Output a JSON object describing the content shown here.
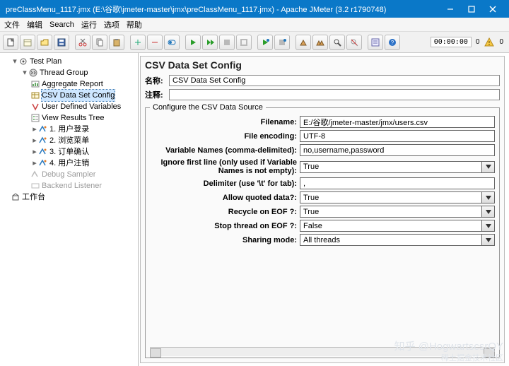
{
  "window": {
    "title": "preClassMenu_1117.jmx (E:\\谷歌\\jmeter-master\\jmx\\preClassMenu_1117.jmx) - Apache JMeter (3.2 r1790748)"
  },
  "menu": {
    "file": "文件",
    "edit": "编辑",
    "search": "Search",
    "run": "运行",
    "options": "选项",
    "help": "帮助"
  },
  "toolbar": {
    "timer": "00:00:00",
    "count": "0",
    "warnCount": "0"
  },
  "tree": {
    "root": "Test Plan",
    "group": "Thread Group",
    "items": [
      "Aggregate Report",
      "CSV Data Set Config",
      "User Defined Variables",
      "View Results Tree",
      "1. 用户登录",
      "2. 浏览菜单",
      "3. 订单确认",
      "4. 用户注销",
      "Debug Sampler",
      "Backend Listener"
    ],
    "workbench": "工作台"
  },
  "panel": {
    "title": "CSV Data Set Config",
    "nameLabel": "名称:",
    "nameValue": "CSV Data Set Config",
    "commentLabel": "注释:",
    "commentValue": "",
    "fieldsetLegend": "Configure the CSV Data Source",
    "fields": {
      "filename": {
        "label": "Filename:",
        "value": "E:/谷歌/jmeter-master/jmx/users.csv"
      },
      "encoding": {
        "label": "File encoding:",
        "value": "UTF-8"
      },
      "varnames": {
        "label": "Variable Names (comma-delimited):",
        "value": "no,username,password"
      },
      "ignoreFirst": {
        "label": "Ignore first line (only used if Variable Names is not empty):",
        "value": "True"
      },
      "delimiter": {
        "label": "Delimiter (use '\\t' for tab):",
        "value": ","
      },
      "allowQuoted": {
        "label": "Allow quoted data?:",
        "value": "True"
      },
      "recycle": {
        "label": "Recycle on EOF ?:",
        "value": "True"
      },
      "stopThread": {
        "label": "Stop thread on EOF ?:",
        "value": "False"
      },
      "sharing": {
        "label": "Sharing mode:",
        "value": "All threads"
      }
    }
  },
  "watermark": {
    "line1": "知乎 @HogwartscsrQY",
    "line2": "稀土掘金技术社区"
  }
}
